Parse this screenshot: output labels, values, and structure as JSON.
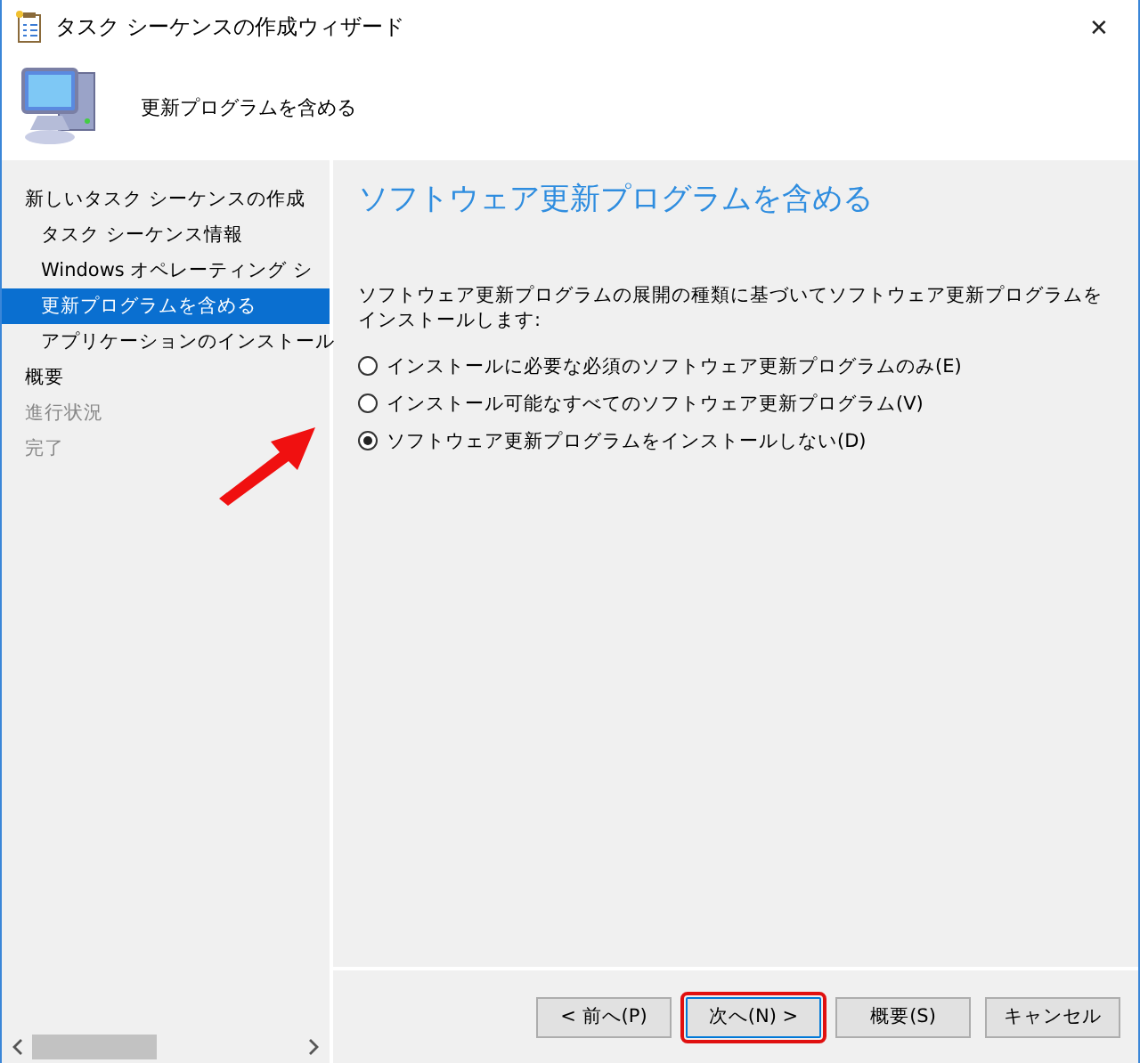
{
  "window": {
    "title": "タスク シーケンスの作成ウィザード",
    "close": "✕"
  },
  "header": {
    "title": "更新プログラムを含める"
  },
  "sidebar": {
    "items": [
      {
        "label": "新しいタスク シーケンスの作成",
        "selected": false,
        "disabled": false,
        "children": [
          {
            "label": "タスク シーケンス情報",
            "selected": false,
            "disabled": false
          },
          {
            "label": "Windows オペレーティング シ",
            "selected": false,
            "disabled": false
          },
          {
            "label": "更新プログラムを含める",
            "selected": true,
            "disabled": false
          },
          {
            "label": "アプリケーションのインストール",
            "selected": false,
            "disabled": false
          }
        ]
      },
      {
        "label": "概要",
        "selected": false,
        "disabled": false
      },
      {
        "label": "進行状況",
        "selected": false,
        "disabled": true
      },
      {
        "label": "完了",
        "selected": false,
        "disabled": true
      }
    ]
  },
  "page": {
    "title": "ソフトウェア更新プログラムを含める",
    "description": "ソフトウェア更新プログラムの展開の種類に基づいてソフトウェア更新プログラムをインストールします:",
    "options": [
      {
        "label": "インストールに必要な必須のソフトウェア更新プログラムのみ(E)",
        "selected": false
      },
      {
        "label": "インストール可能なすべてのソフトウェア更新プログラム(V)",
        "selected": false
      },
      {
        "label": "ソフトウェア更新プログラムをインストールしない(D)",
        "selected": true
      }
    ]
  },
  "buttons": [
    {
      "label": "< 前へ(P)",
      "focused": false,
      "highlighted": false
    },
    {
      "label": "次へ(N) >",
      "focused": true,
      "highlighted": true
    },
    {
      "label": "概要(S)",
      "focused": false,
      "highlighted": false
    },
    {
      "label": "キャンセル",
      "focused": false,
      "highlighted": false
    }
  ]
}
